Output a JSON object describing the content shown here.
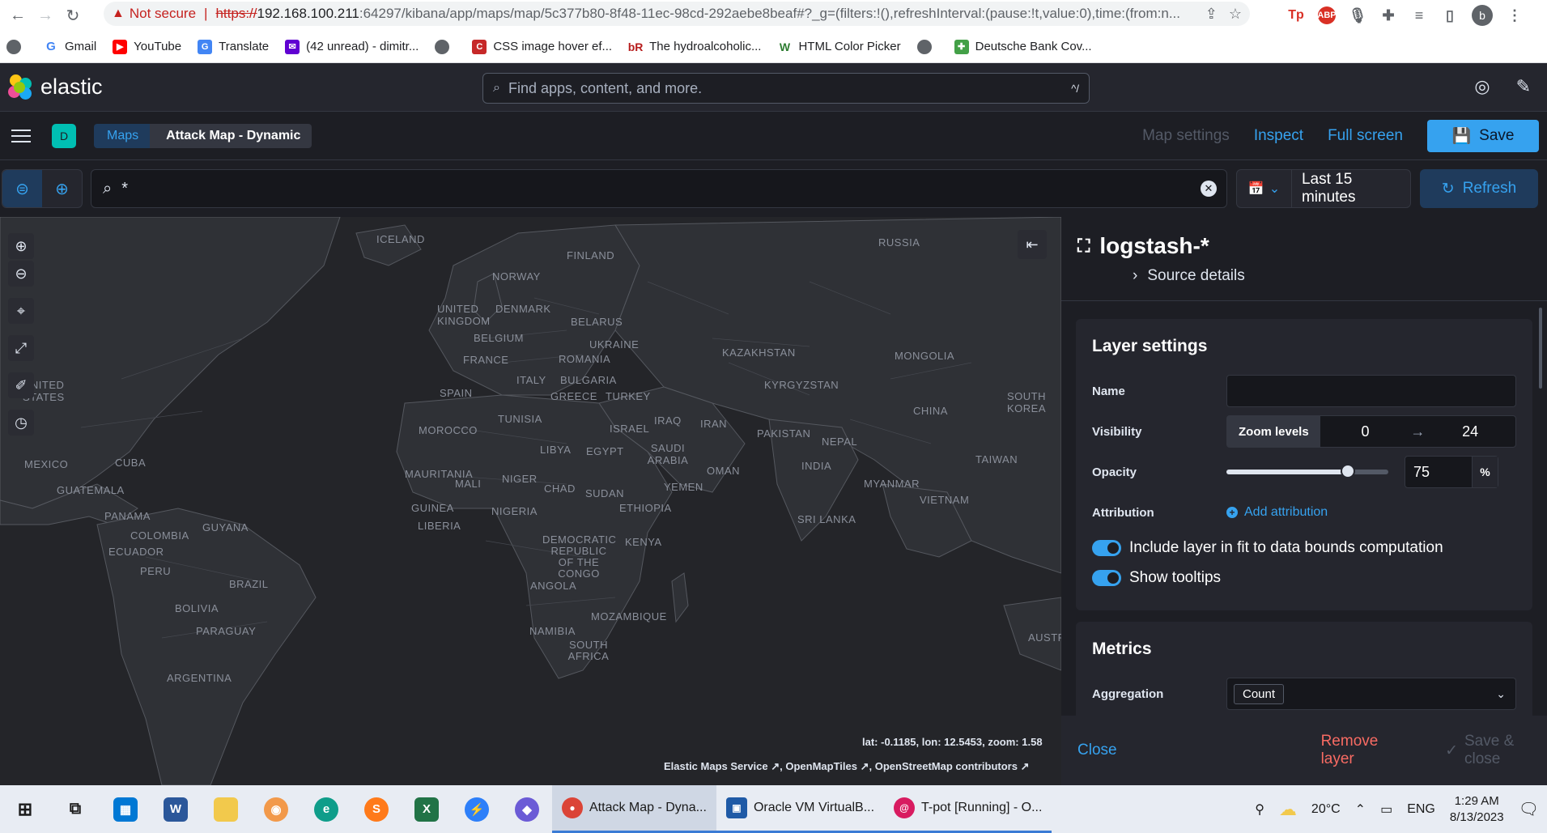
{
  "browser": {
    "not_secure": "Not secure",
    "url_scheme": "https://",
    "url_host": "192.168.100.211",
    "url_path": ":64297/kibana/app/maps/map/5c377b80-8f48-11ec-98cd-292aebe8beaf#?_g=(filters:!(),refreshInterval:(pause:!t,value:0),time:(from:n...",
    "profile_initial": "b",
    "bookmarks": [
      "Gmail",
      "YouTube",
      "Translate",
      "(42 unread) - dimitr...",
      "CSS image hover ef...",
      "The hydroalcoholic...",
      "HTML Color Picker",
      "Deutsche Bank Cov..."
    ]
  },
  "kibana": {
    "logo_text": "elastic",
    "search_placeholder": "Find apps, content, and more.",
    "search_shortcut": "^/",
    "space_initial": "D",
    "breadcrumbs": [
      "Maps",
      "Attack Map - Dynamic"
    ],
    "links": {
      "map_settings": "Map settings",
      "inspect": "Inspect",
      "full_screen": "Full screen",
      "save": "Save"
    },
    "query": "*",
    "time_range": "Last 15 minutes",
    "refresh": "Refresh"
  },
  "map": {
    "labels": [
      "ICELAND",
      "FINLAND",
      "RUSSIA",
      "NORWAY",
      "UNITED KINGDOM",
      "DENMARK",
      "BELARUS",
      "BELGIUM",
      "UKRAINE",
      "FRANCE",
      "ROMANIA",
      "KAZAKHSTAN",
      "MONGOLIA",
      "ITALY",
      "BULGARIA",
      "SPAIN",
      "GREECE",
      "TURKEY",
      "KYRGYZSTAN",
      "UNITED STATES",
      "SOUTH KOREA",
      "CHINA",
      "TUNISIA",
      "MOROCCO",
      "ISRAEL",
      "IRAQ",
      "IRAN",
      "PAKISTAN",
      "NEPAL",
      "LIBYA",
      "EGYPT",
      "SAUDI ARABIA",
      "TAIWAN",
      "MEXICO",
      "CUBA",
      "INDIA",
      "MAURITANIA",
      "OMAN",
      "GUATEMALA",
      "MALI",
      "NIGER",
      "CHAD",
      "SUDAN",
      "YEMEN",
      "MYANMAR",
      "VIETNAM",
      "GUINEA",
      "NIGERIA",
      "ETHIOPIA",
      "PANAMA",
      "GUYANA",
      "SRI LANKA",
      "LIBERIA",
      "COLOMBIA",
      "DEMOCRATIC REPUBLIC OF THE CONGO",
      "KENYA",
      "ECUADOR",
      "PERU",
      "BRAZIL",
      "ANGOLA",
      "BOLIVIA",
      "MOZAMBIQUE",
      "PARAGUAY",
      "NAMIBIA",
      "SOUTH AFRICA",
      "ARGENTINA",
      "AUSTR"
    ],
    "coords": "lat: -0.1185, lon: 12.5453, zoom: 1.58",
    "attribution": [
      "Elastic Maps Service",
      "OpenMapTiles",
      "OpenStreetMap contributors"
    ]
  },
  "panel": {
    "layer_name": "logstash-*",
    "source_details": "Source details",
    "layer_settings_title": "Layer settings",
    "name_label": "Name",
    "name_value": "",
    "visibility_label": "Visibility",
    "zoom_levels_label": "Zoom levels",
    "zoom_min": "0",
    "zoom_max": "24",
    "opacity_label": "Opacity",
    "opacity_value": "75",
    "opacity_unit": "%",
    "opacity_fraction": 0.75,
    "attribution_label": "Attribution",
    "add_attribution": "Add attribution",
    "toggle_fit": "Include layer in fit to data bounds computation",
    "toggle_tooltips": "Show tooltips",
    "metrics_title": "Metrics",
    "aggregation_label": "Aggregation",
    "aggregation_value": "Count",
    "close": "Close",
    "remove_layer": "Remove layer",
    "save_close": "Save & close"
  },
  "taskbar": {
    "apps": [
      "Attack Map - Dyna...",
      "Oracle VM VirtualB...",
      "T-pot [Running] - O..."
    ],
    "weather": "20°C",
    "lang": "ENG",
    "time": "1:29 AM",
    "date": "8/13/2023"
  }
}
